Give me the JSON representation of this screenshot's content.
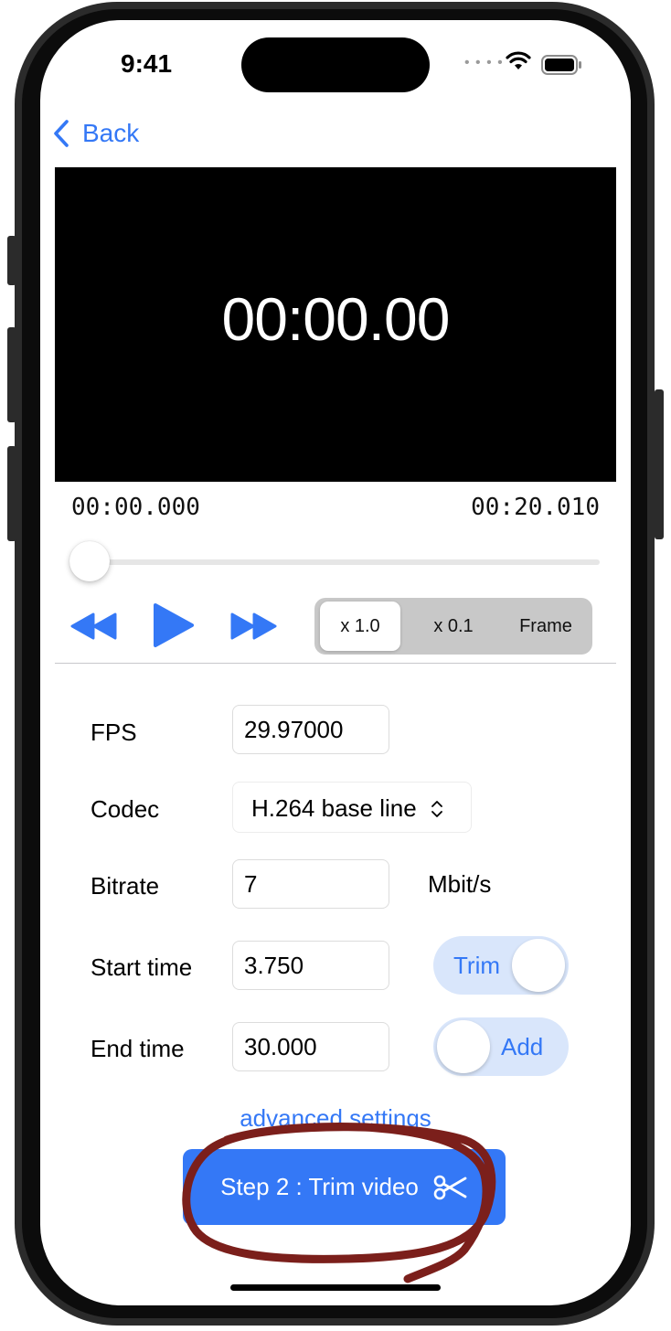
{
  "status_bar": {
    "time": "9:41"
  },
  "nav": {
    "back_label": "Back"
  },
  "player": {
    "display_time": "00:00.00",
    "current_time": "00:00.000",
    "total_time": "00:20.010",
    "playhead_position": 0.0,
    "speed_options": [
      "x 1.0",
      "x 0.1",
      "Frame"
    ],
    "selected_speed": "x 1.0"
  },
  "form": {
    "fps": {
      "label": "FPS",
      "value": "29.97000"
    },
    "codec": {
      "label": "Codec",
      "value": "H.264 base line"
    },
    "bitrate": {
      "label": "Bitrate",
      "value": "7",
      "unit": "Mbit/s"
    },
    "start_time": {
      "label": "Start time",
      "value": "3.750",
      "toggle_label": "Trim",
      "toggle_on": true
    },
    "end_time": {
      "label": "End time",
      "value": "30.000",
      "toggle_label": "Add",
      "toggle_on": false
    }
  },
  "advanced_link": "advanced settings",
  "primary_button": "Step 2 : Trim video",
  "colors": {
    "accent": "#3478f6",
    "annotation": "#7b1f1b",
    "video_bg": "#000000"
  }
}
